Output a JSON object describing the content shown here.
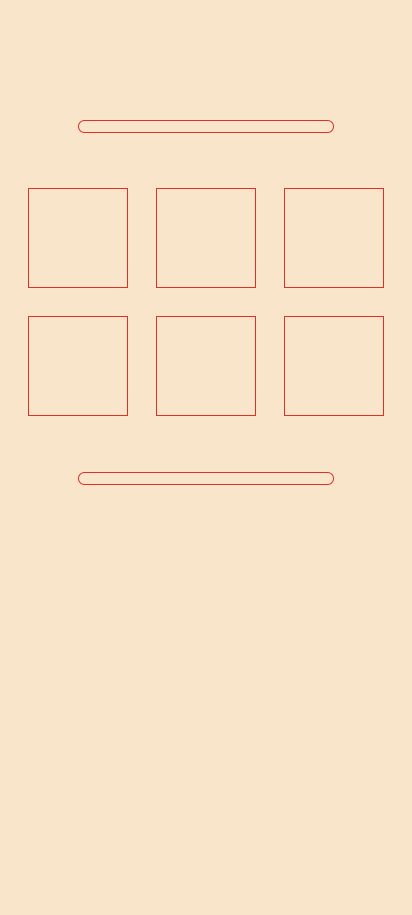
{
  "colors": {
    "background": "#f9e5c9",
    "outline": "#e0302a"
  },
  "top_bar": {
    "text": ""
  },
  "bottom_bar": {
    "text": ""
  },
  "tiles": [
    {
      "label": ""
    },
    {
      "label": ""
    },
    {
      "label": ""
    },
    {
      "label": ""
    },
    {
      "label": ""
    },
    {
      "label": ""
    }
  ]
}
